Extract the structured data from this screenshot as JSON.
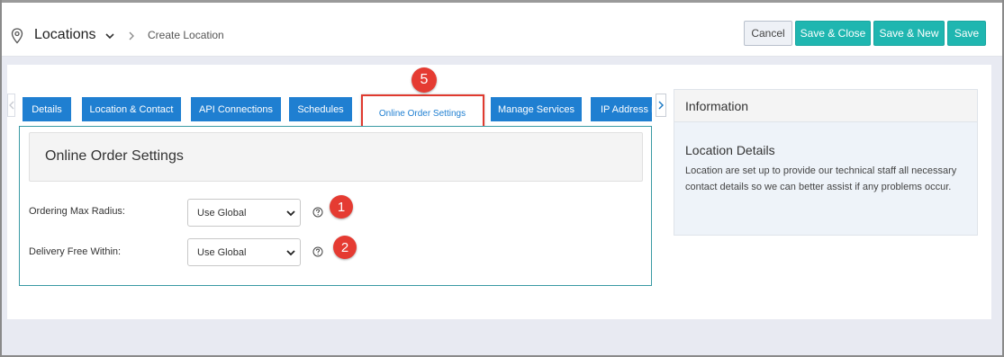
{
  "header": {
    "section_title": "Locations",
    "breadcrumb_current": "Create Location"
  },
  "toolbar": {
    "cancel_label": "Cancel",
    "save_close_label": "Save & Close",
    "save_new_label": "Save & New",
    "save_label": "Save"
  },
  "tabs": [
    {
      "label": "Details"
    },
    {
      "label": "Location & Contact"
    },
    {
      "label": "API Connections"
    },
    {
      "label": "Schedules"
    },
    {
      "label": "Online Order Settings",
      "active": true
    },
    {
      "label": "Manage Services"
    },
    {
      "label": "IP Address R"
    }
  ],
  "form": {
    "title": "Online Order Settings",
    "fields": [
      {
        "label": "Ordering Max Radius:",
        "value": "Use Global"
      },
      {
        "label": "Delivery Free Within:",
        "value": "Use Global"
      }
    ]
  },
  "info": {
    "title": "Information",
    "subtitle": "Location Details",
    "body": "Location are set up to provide our technical staff all necessary contact details so we can better assist if any problems occur."
  },
  "callouts": [
    "5",
    "1",
    "2"
  ],
  "colors": {
    "tab_blue": "#1f7fd1",
    "teal": "#1fb6b0",
    "callout_red": "#e53b32",
    "panel_border": "#3a9aa4"
  },
  "icons": [
    "map-pin-icon",
    "chevron-down-icon",
    "chevron-right-icon",
    "help-circle-icon",
    "chevron-left-icon"
  ]
}
